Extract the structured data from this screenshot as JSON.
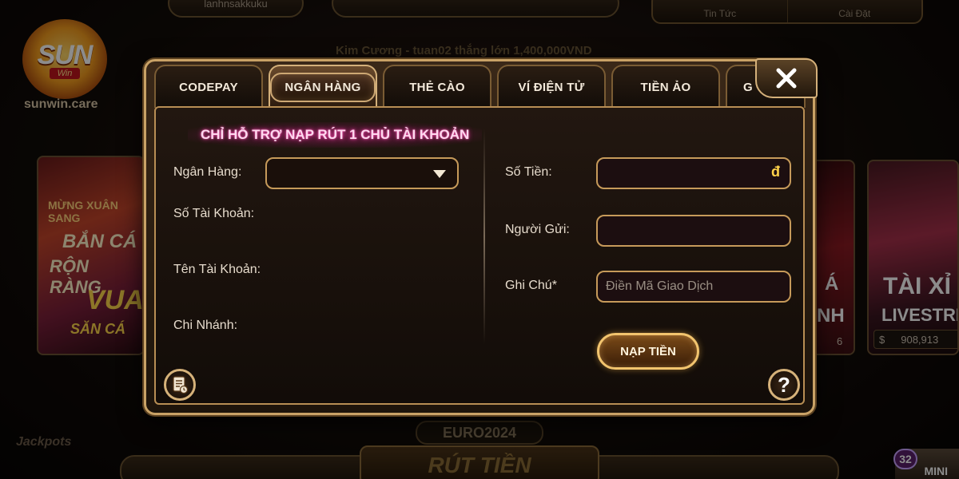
{
  "background": {
    "top_pill_text": "lanhnsakkuku",
    "nav_right": [
      "Tin Tức",
      "Cài Đặt"
    ],
    "ticker": "Kim Cương - tuan02 thắng lớn 1,400,000VND",
    "logo": {
      "main": "SUN",
      "sub": "Win",
      "url": "sunwin.care"
    },
    "game_left": {
      "line1": "MỪNG XUÂN SANG",
      "line2": "BẮN CÁ",
      "line3": "RỘN RÀNG",
      "line4": "VUA",
      "line5": "SĂN CÁ"
    },
    "game_mid": {
      "line1": "Á",
      "line2": "NH",
      "line3": "6"
    },
    "game_right": {
      "line1": "TÀI XỈ",
      "line2": "LIVESTREA",
      "currency_symbol": "$",
      "amount": "908,913"
    },
    "euro_badge": "EURO2024",
    "withdraw_label": "RÚT TIỀN",
    "jackpot_label": "Jackpots",
    "mini_badge_count": "32",
    "mini_label": "MINI"
  },
  "modal": {
    "tabs": [
      {
        "label": "CODEPAY",
        "active": false
      },
      {
        "label": "NGÂN HÀNG",
        "active": true
      },
      {
        "label": "THẺ CÀO",
        "active": false
      },
      {
        "label": "VÍ ĐIỆN TỬ",
        "active": false
      },
      {
        "label": "TIỀN ẢO",
        "active": false
      },
      {
        "label": "G",
        "active": false
      }
    ],
    "notice": "CHỈ HỖ TRỢ NẠP RÚT 1 CHỦ TÀI KHOẢN",
    "left_form": {
      "bank_label": "Ngân Hàng:",
      "bank_selected": "",
      "account_number_label": "Số Tài Khoản:",
      "account_number_value": "",
      "account_name_label": "Tên Tài Khoản:",
      "account_name_value": "",
      "branch_label": "Chi Nhánh:",
      "branch_value": ""
    },
    "right_form": {
      "amount_label": "Số Tiền:",
      "amount_value": "",
      "amount_currency": "đ",
      "sender_label": "Người Gửi:",
      "sender_value": "",
      "note_label": "Ghi Chú*",
      "note_placeholder": "Điền Mã Giao Dịch",
      "submit_label": "NẠP TIỀN"
    }
  },
  "colors": {
    "accent_gold": "#c9a266",
    "notice_pink": "#e0389a",
    "currency_yellow": "#ffd24a"
  },
  "icons": {
    "close": "close-icon",
    "history": "history-icon",
    "help": "help-icon"
  }
}
